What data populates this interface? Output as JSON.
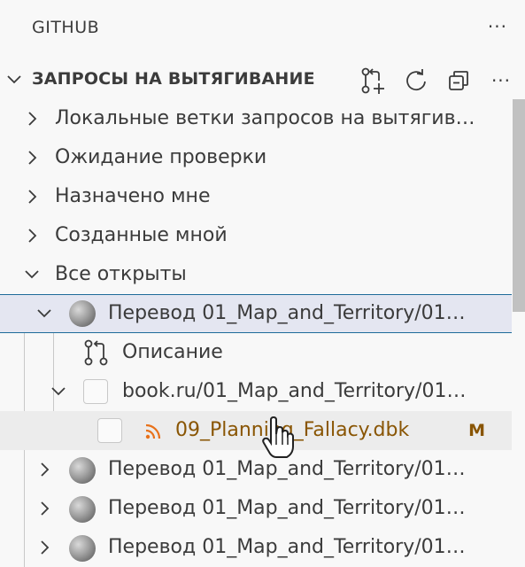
{
  "view": {
    "title": "GITHUB",
    "more": "···"
  },
  "section": {
    "title": "ЗАПРОСЫ НА ВЫТЯГИВАНИЕ",
    "actions": [
      "create-pr-icon",
      "refresh-icon",
      "collapse-all-icon",
      "more-icon"
    ],
    "more": "···"
  },
  "tree": {
    "items": [
      {
        "label": "Локальные ветки запросов на вытягив…"
      },
      {
        "label": "Ожидание проверки"
      },
      {
        "label": "Назначено мне"
      },
      {
        "label": "Созданные мной"
      },
      {
        "label": "Все открыты"
      },
      {
        "label": "Перевод 01_Map_and_Territory/01…"
      },
      {
        "label": "Описание"
      },
      {
        "label": "book.ru/01_Map_and_Territory/01…"
      },
      {
        "label": "09_Planning_Fallacy.dbk",
        "badge": "M"
      },
      {
        "label": "Перевод 01_Map_and_Territory/01…"
      },
      {
        "label": "Перевод 01_Map_and_Territory/01…"
      },
      {
        "label": "Перевод 01_Map_and_Territory/01…"
      }
    ]
  },
  "colors": {
    "accent": "#1f6b9a",
    "modified": "#895503",
    "rss": "#e8711a"
  }
}
